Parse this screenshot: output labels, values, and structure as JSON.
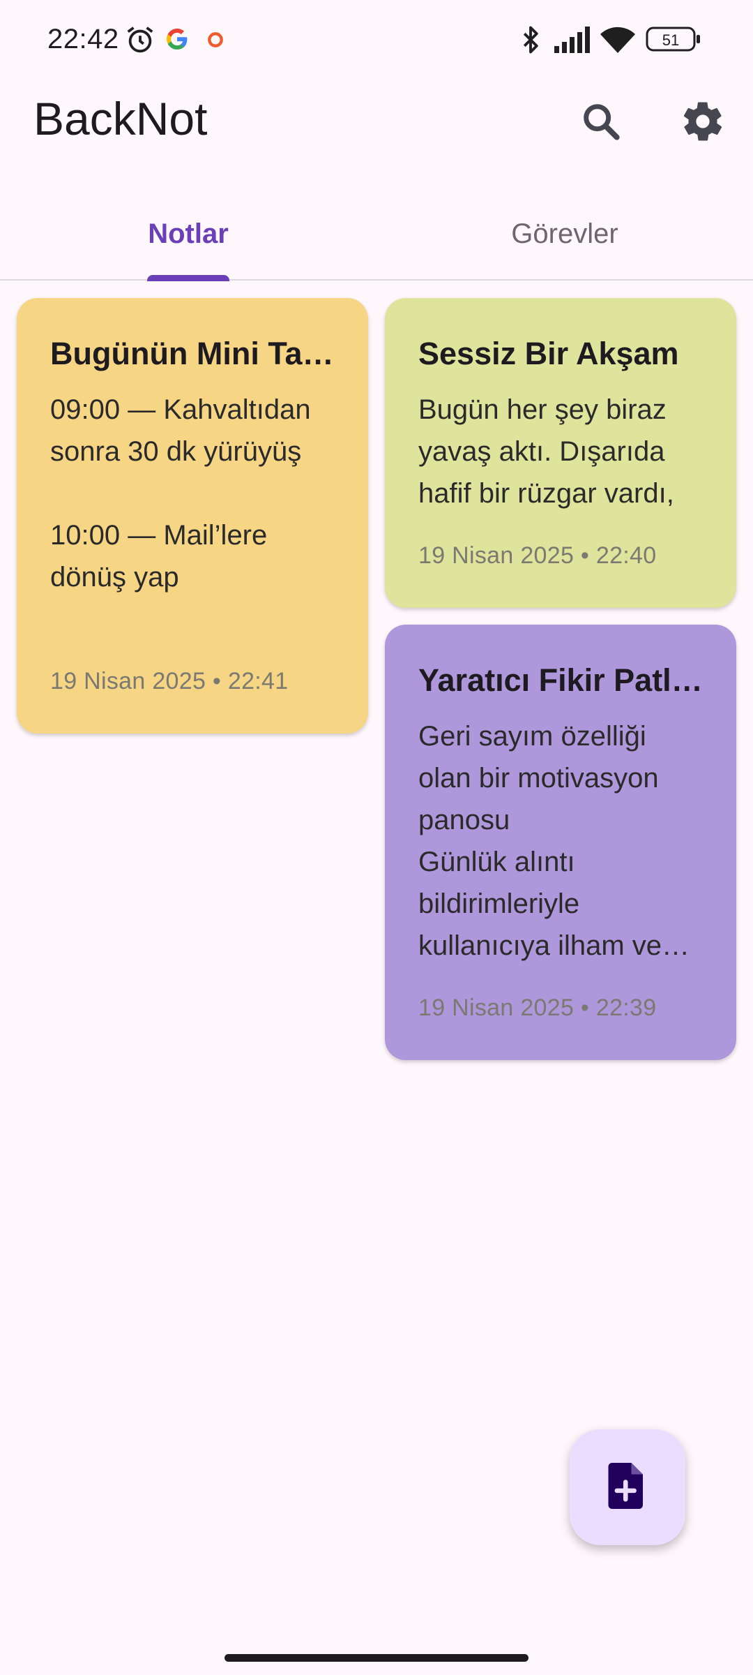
{
  "status_bar": {
    "time": "22:42",
    "battery": "51",
    "icons": [
      "alarm-icon",
      "google-icon",
      "notification-dot-icon",
      "bluetooth-icon",
      "signal-icon",
      "wifi-icon",
      "battery-icon"
    ]
  },
  "app_bar": {
    "title": "BackNot",
    "actions": [
      "search-icon",
      "settings-icon"
    ]
  },
  "tabs": [
    {
      "label": "Notlar",
      "active": true
    },
    {
      "label": "Görevler",
      "active": false
    }
  ],
  "notes": [
    {
      "title": "Bugünün Mini Takvimi",
      "body": "09:00 — Kahvaltıdan sonra 30 dk yürüyüş\n\n10:00 — Mail’lere dönüş yap",
      "date": "19 Nisan 2025 • 22:41",
      "color": "#f6d585"
    },
    {
      "title": "Sessiz Bir Akşam",
      "body": "Bugün her şey biraz yavaş aktı. Dışarıda hafif bir rüzgar vardı,",
      "date": "19 Nisan 2025 • 22:40",
      "color": "#dee49c"
    },
    {
      "title": "Yaratıcı Fikir Patlaması",
      "body": "Geri sayım özelliği olan bir motivasyon panosu\nGünlük alıntı bildirimleriyle kullanıcıya ilham ve…",
      "date": "19 Nisan 2025 • 22:39",
      "color": "#ae97da"
    }
  ],
  "fab": {
    "icon": "add-note-icon"
  },
  "colors": {
    "accent": "#6a3fb7",
    "background": "#fef7fc",
    "fab": "#eaddff"
  }
}
